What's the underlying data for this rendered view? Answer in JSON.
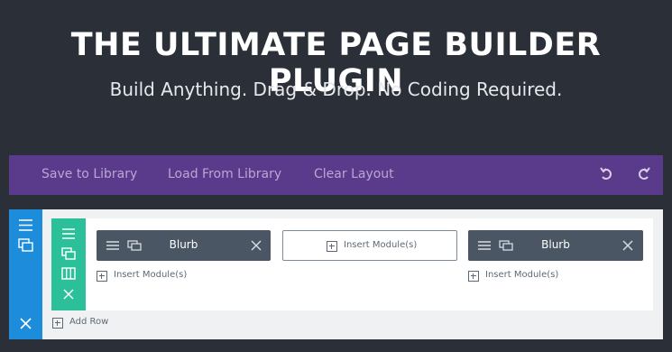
{
  "hero": {
    "title": "THE ULTIMATE PAGE BUILDER PLUGIN",
    "subtitle": "Build Anything. Drag & Drop. No Coding Required."
  },
  "toolbar": {
    "save_label": "Save to Library",
    "load_label": "Load From Library",
    "clear_label": "Clear Layout"
  },
  "row": {
    "col1": {
      "module_label": "Blurb",
      "insert_label": "Insert Module(s)"
    },
    "col2": {
      "insert_label": "Insert Module(s)"
    },
    "col3": {
      "module_label": "Blurb",
      "insert_label": "Insert Module(s)"
    }
  },
  "add_row_label": "Add Row",
  "colors": {
    "background": "#2b3038",
    "toolbar": "#5a3a8a",
    "section": "#1d8cdb",
    "row": "#2bc09a",
    "module": "#4a5663"
  }
}
